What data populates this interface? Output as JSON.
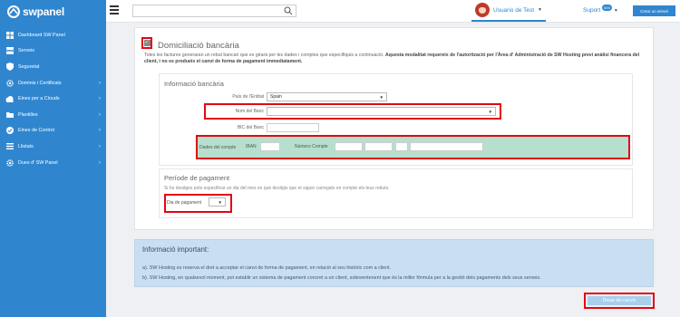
{
  "brand": {
    "name": "swpanel"
  },
  "sidebar": {
    "items": [
      {
        "label": "Dashboard SW Panel",
        "icon": "dashboard-icon",
        "chevron": ""
      },
      {
        "label": "Serveis",
        "icon": "server-icon",
        "chevron": ""
      },
      {
        "label": "Seguretat",
        "icon": "shield-icon",
        "chevron": ""
      },
      {
        "label": "Dominis i Certificats",
        "icon": "gear-icon",
        "chevron": "›"
      },
      {
        "label": "Eines per a Clouds",
        "icon": "cloud-icon",
        "chevron": "›"
      },
      {
        "label": "Plantilles",
        "icon": "folder-icon",
        "chevron": "›"
      },
      {
        "label": "Eines de Control",
        "icon": "check-circle-icon",
        "chevron": "›"
      },
      {
        "label": "Llistats",
        "icon": "list-icon",
        "chevron": "›"
      },
      {
        "label": "Dues d' SW Panel",
        "icon": "gear-icon",
        "chevron": "›"
      }
    ]
  },
  "topbar": {
    "search_placeholder": "",
    "user_name": "Usuario de Test",
    "support_label": "Suport",
    "support_badge": "600",
    "new_server_label": "Crear un servei"
  },
  "direct_debit": {
    "checked": true,
    "title": "Domiciliació bancària",
    "description_normal": "Totes les factures generaran un rebut bancari que es girarà per les dades i comptes que especifiquis a continuació. ",
    "description_bold": "Aquesta modalitat requereix de l'autorització per l'Àrea d' Administració de SW Hosting previ anàlisi financera del client, i no es produeix el canvi de forma de pagament immediatament."
  },
  "bank_info": {
    "title": "Informació bancària",
    "country_label": "País de l'Entitat",
    "country_value": "Spain",
    "bank_name_label": "Nom del Banc",
    "bank_name_value": "",
    "bic_label": "BIC del Banc",
    "account_label": "Dades del compte",
    "iban_label": "IBAN",
    "account_number_label": "Número Compte"
  },
  "payment_period": {
    "title": "Període de pagament",
    "hint": "Si ho desitges pots especificar un dia del mes en què desitgis que et siguin carregats en compte els teus rebuts.",
    "day_label": "Dia de pagament",
    "day_value": ""
  },
  "important": {
    "title": "Informació important:",
    "line_a": "a). SW Hosting es reserva el dret a acceptar el canvi de forma de pagament, en relació al seu històric com a client.",
    "line_b": "b). SW Hosting, en qualsevol moment, pot establir un sistema de pagament concret a un client, sobreentenent que és la millor fórmula per a la gestió dels pagaments dels seus serveis."
  },
  "submit": {
    "label": "Desar els canvis"
  },
  "colors": {
    "accent": "#2f86cf",
    "highlight": "#e30613",
    "account_row": "#b6e0cd",
    "info_bg": "#c9dff1"
  }
}
